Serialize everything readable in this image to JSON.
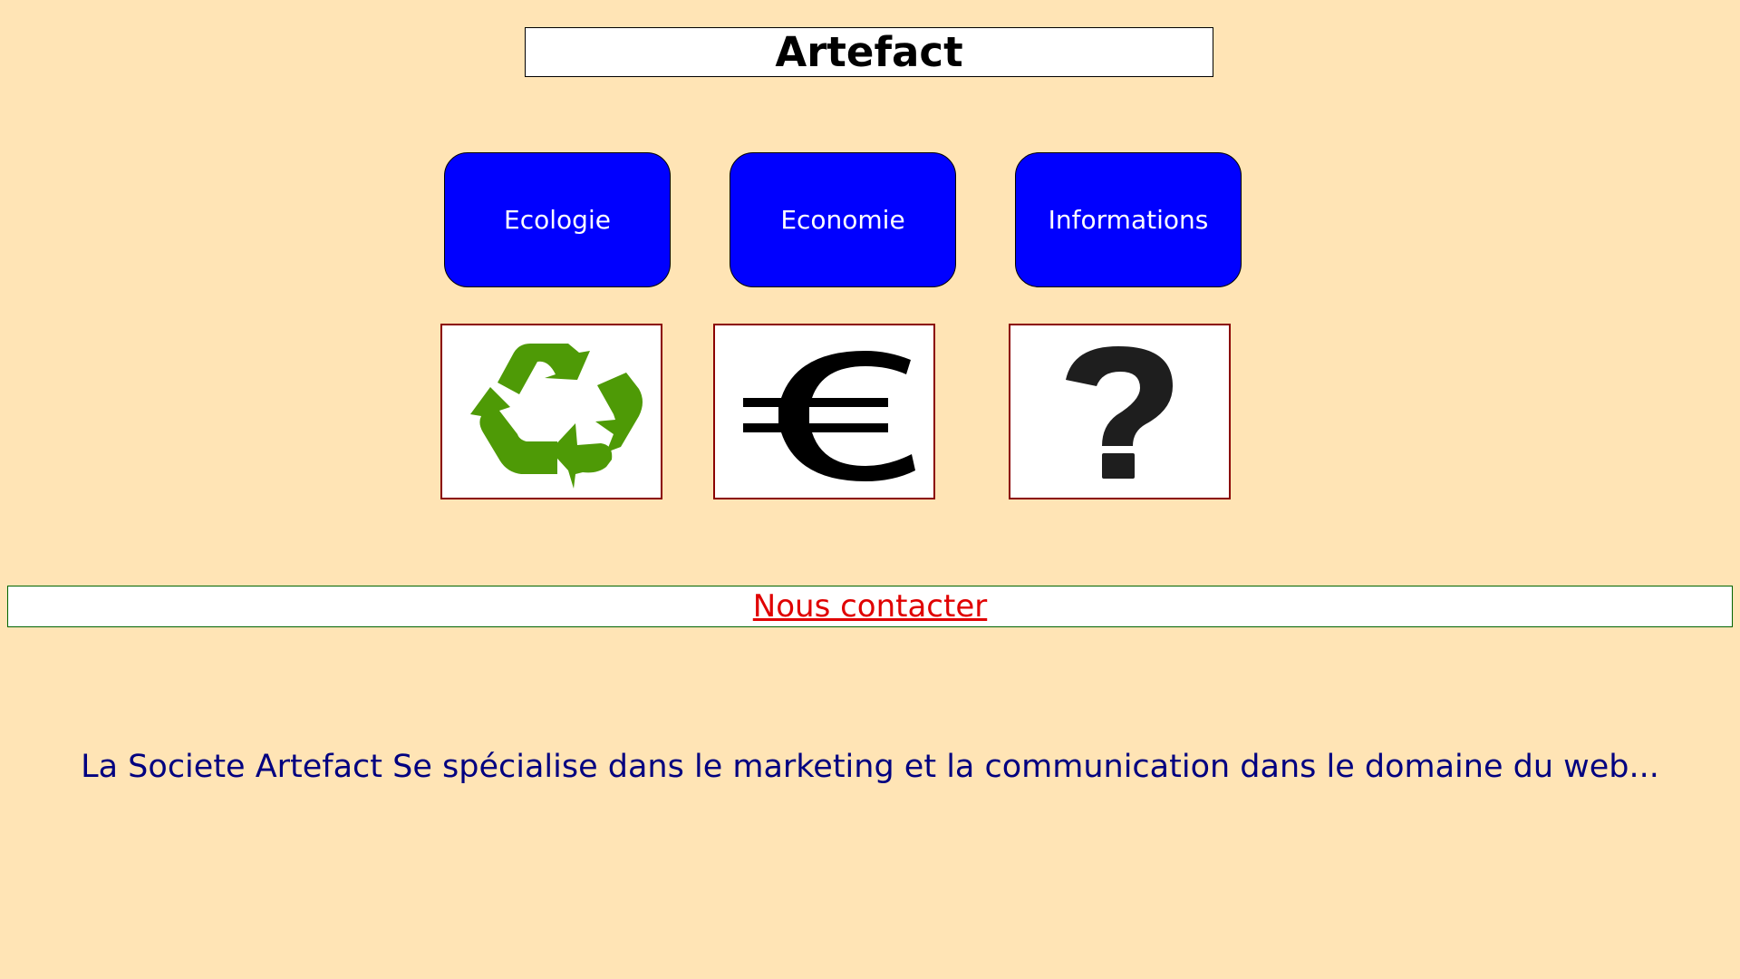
{
  "header": {
    "title": "Artefact"
  },
  "nav": {
    "buttons": [
      {
        "label": "Ecologie"
      },
      {
        "label": "Economie"
      },
      {
        "label": "Informations"
      }
    ]
  },
  "icons": [
    {
      "name": "recycle-icon",
      "color": "#4E9A06"
    },
    {
      "name": "euro-icon",
      "color": "#000000"
    },
    {
      "name": "question-mark-icon",
      "color": "#1E1E1E"
    }
  ],
  "contact": {
    "link_label": "Nous contacter"
  },
  "main": {
    "description": "La Societe Artefact Se spécialise dans le marketing et la communication dans le domaine du web..."
  },
  "colors": {
    "background": "#FFE4B5",
    "nav_button": "#0000FF",
    "icon_border": "#8B0000",
    "contact_border": "#006400",
    "contact_link": "#E00000",
    "description_text": "#000080"
  }
}
